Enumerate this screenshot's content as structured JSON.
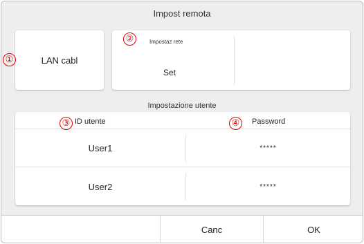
{
  "screen": {
    "title": "Impost remota"
  },
  "connection": {
    "lan_label": "LAN cabl"
  },
  "network": {
    "caption": "Impostaz rete",
    "value": "Set"
  },
  "user_settings": {
    "title": "Impostazione utente",
    "col_id": "ID utente",
    "col_password": "Password",
    "rows": [
      {
        "id": "User1",
        "password": "*****"
      },
      {
        "id": "User2",
        "password": "*****"
      }
    ]
  },
  "buttons": {
    "cancel": "Canc",
    "ok": "OK"
  },
  "callouts": [
    "①",
    "②",
    "③",
    "④"
  ],
  "colors": {
    "callout": "#e00000",
    "background": "#eeeeee",
    "card": "#ffffff"
  }
}
